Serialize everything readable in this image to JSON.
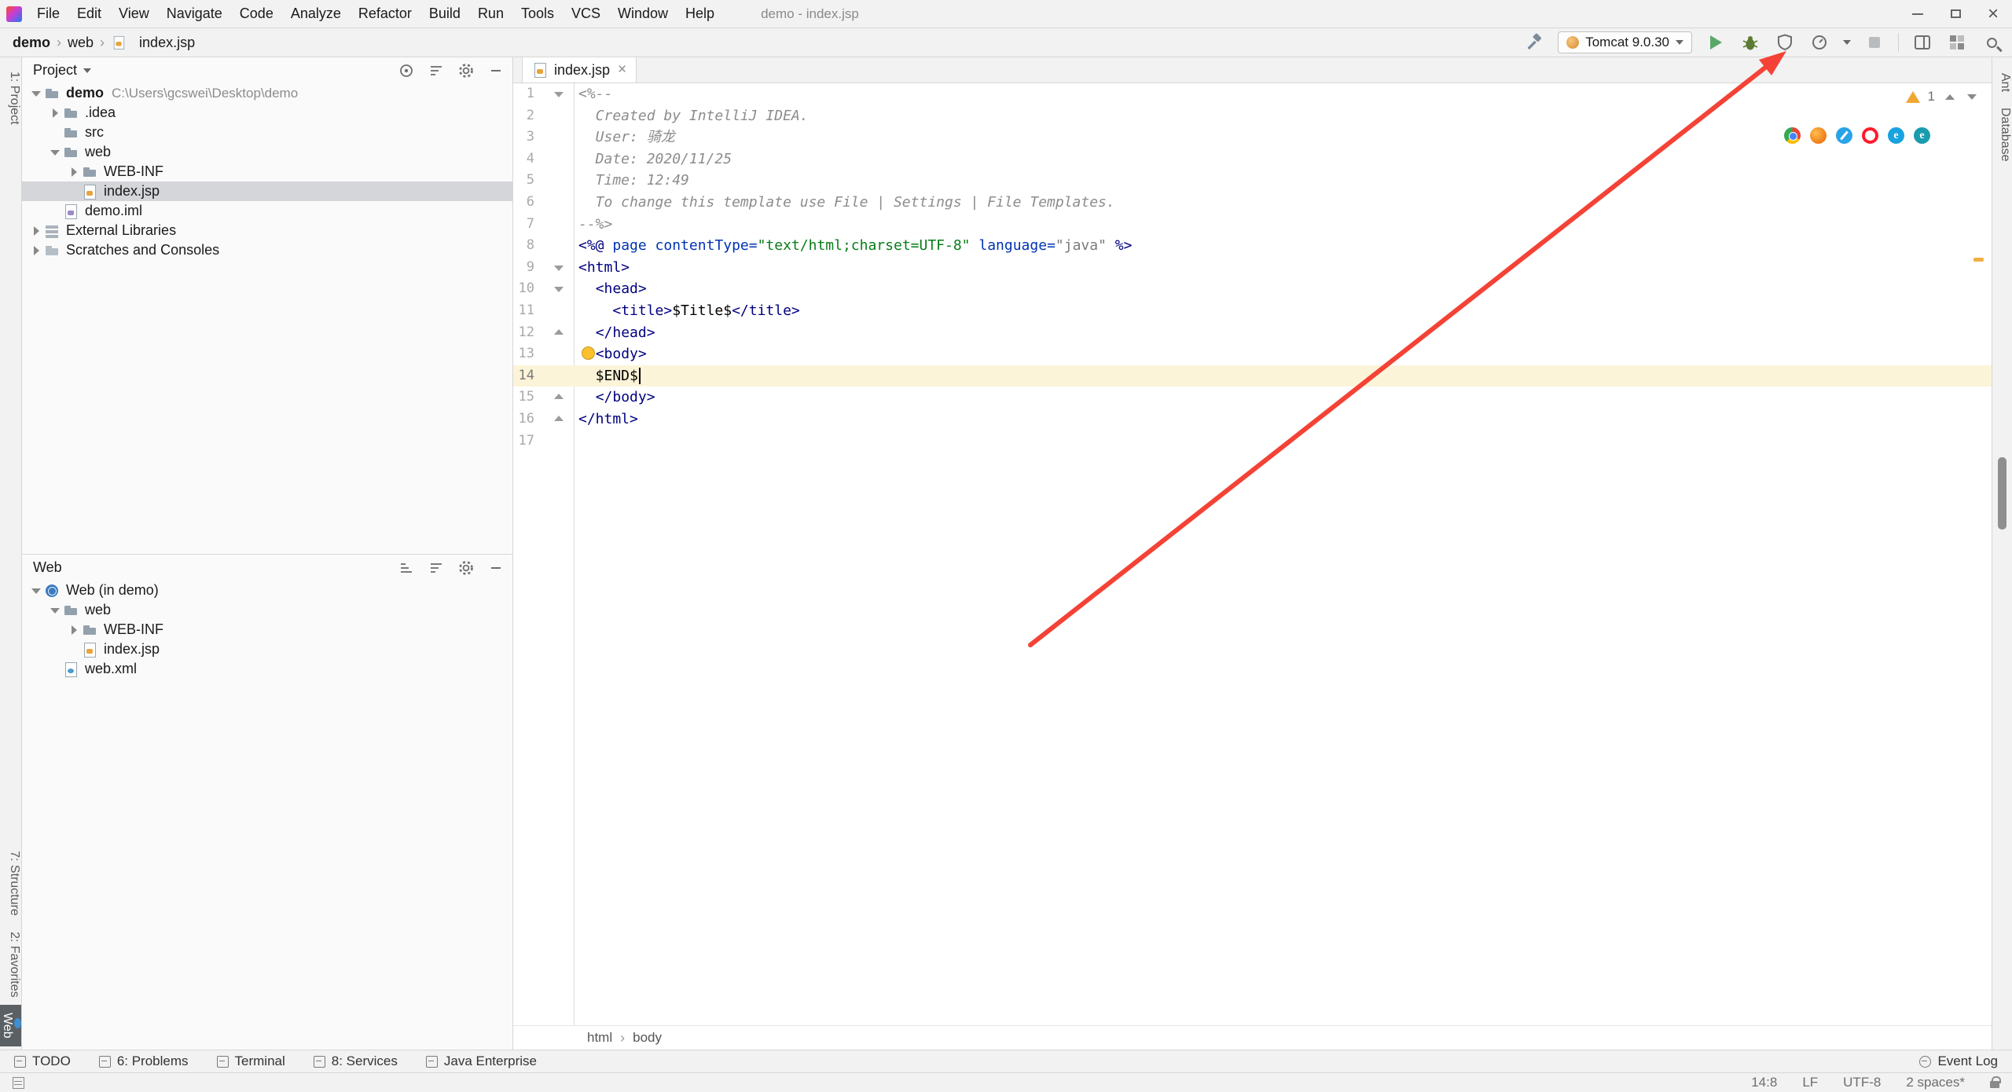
{
  "colors": {
    "annotation_arrow": "#f44336",
    "selection": "#d4d6d9",
    "current_line": "#fcf4d8",
    "run_green": "#59a869",
    "warning_yellow": "#f0a732"
  },
  "titlebar": {
    "title": "demo - index.jsp",
    "menus": [
      "File",
      "Edit",
      "View",
      "Navigate",
      "Code",
      "Analyze",
      "Refactor",
      "Build",
      "Run",
      "Tools",
      "VCS",
      "Window",
      "Help"
    ]
  },
  "toolbar": {
    "separator": "›",
    "breadcrumbs": [
      {
        "label": "demo",
        "bold": true
      },
      {
        "label": "web"
      },
      {
        "label": "index.jsp",
        "icon": "jsp"
      }
    ],
    "run_config": "Tomcat 9.0.30"
  },
  "left_strip": {
    "top": [
      {
        "label": "1: Project",
        "active": false
      }
    ],
    "bottom": [
      {
        "label": "7: Structure",
        "active": false
      },
      {
        "label": "2: Favorites",
        "active": false
      },
      {
        "label": "Web",
        "active": true
      }
    ]
  },
  "right_strip": [
    "Ant",
    "Database"
  ],
  "project_panel": {
    "title": "Project",
    "tree": [
      {
        "depth": 0,
        "chevron": "down",
        "icon": "folder",
        "label": "demo",
        "bold": true,
        "suffix": "C:\\Users\\gcswei\\Desktop\\demo"
      },
      {
        "depth": 1,
        "chevron": "right",
        "icon": "folder",
        "label": ".idea"
      },
      {
        "depth": 1,
        "chevron": "none",
        "icon": "folder",
        "label": "src"
      },
      {
        "depth": 1,
        "chevron": "down",
        "icon": "folder",
        "label": "web"
      },
      {
        "depth": 2,
        "chevron": "right",
        "icon": "folder",
        "label": "WEB-INF"
      },
      {
        "depth": 2,
        "chevron": "none",
        "icon": "jsp",
        "label": "index.jsp",
        "selected": true
      },
      {
        "depth": 1,
        "chevron": "none",
        "icon": "iml",
        "label": "demo.iml"
      },
      {
        "depth": 0,
        "chevron": "right",
        "icon": "lib",
        "label": "External Libraries"
      },
      {
        "depth": 0,
        "chevron": "right",
        "icon": "scratch",
        "label": "Scratches and Consoles"
      }
    ]
  },
  "web_panel": {
    "title": "Web",
    "tree": [
      {
        "depth": 0,
        "chevron": "down",
        "icon": "webmodule",
        "label": "Web (in demo)"
      },
      {
        "depth": 1,
        "chevron": "down",
        "icon": "folder",
        "label": "web"
      },
      {
        "depth": 2,
        "chevron": "right",
        "icon": "folder",
        "label": "WEB-INF"
      },
      {
        "depth": 2,
        "chevron": "none",
        "icon": "jsp",
        "label": "index.jsp"
      },
      {
        "depth": 1,
        "chevron": "none",
        "icon": "webxml",
        "label": "web.xml"
      }
    ]
  },
  "editor": {
    "tab": {
      "label": "index.jsp",
      "close": "×"
    },
    "warning_badge": "1",
    "breadcrumb_separator": "›",
    "breadcrumbs": [
      "html",
      "body"
    ],
    "current_line": 14,
    "lines": [
      {
        "n": 1,
        "fold": "down",
        "seg": [
          {
            "t": "<%--",
            "c": "comment"
          }
        ]
      },
      {
        "n": 2,
        "seg": [
          {
            "t": "  Created by IntelliJ IDEA.",
            "c": "comment"
          }
        ]
      },
      {
        "n": 3,
        "seg": [
          {
            "t": "  User: 骑龙",
            "c": "comment"
          }
        ]
      },
      {
        "n": 4,
        "seg": [
          {
            "t": "  Date: 2020/11/25",
            "c": "comment"
          }
        ]
      },
      {
        "n": 5,
        "seg": [
          {
            "t": "  Time: 12:49",
            "c": "comment"
          }
        ]
      },
      {
        "n": 6,
        "seg": [
          {
            "t": "  To change this template use File | Settings | File Templates.",
            "c": "comment"
          }
        ]
      },
      {
        "n": 7,
        "seg": [
          {
            "t": "--%>",
            "c": "comment"
          }
        ]
      },
      {
        "n": 8,
        "seg": [
          {
            "t": "<%@ ",
            "c": "tag"
          },
          {
            "t": "page ",
            "c": "keyword"
          },
          {
            "t": "contentType=",
            "c": "keyword"
          },
          {
            "t": "\"text/html;charset=UTF-8\"",
            "c": "string"
          },
          {
            "t": " ",
            "c": "plain"
          },
          {
            "t": "language=",
            "c": "keyword"
          },
          {
            "t": "\"java\"",
            "c": "stringlight"
          },
          {
            "t": " %>",
            "c": "tag"
          }
        ]
      },
      {
        "n": 9,
        "fold": "down",
        "seg": [
          {
            "t": "<html>",
            "c": "tag"
          }
        ]
      },
      {
        "n": 10,
        "fold": "down",
        "seg": [
          {
            "t": "  ",
            "c": "plain"
          },
          {
            "t": "<head>",
            "c": "tag"
          }
        ]
      },
      {
        "n": 11,
        "seg": [
          {
            "t": "    ",
            "c": "plain"
          },
          {
            "t": "<title>",
            "c": "tag"
          },
          {
            "t": "$Title$",
            "c": "plain"
          },
          {
            "t": "</title>",
            "c": "tag"
          }
        ]
      },
      {
        "n": 12,
        "fold": "up",
        "seg": [
          {
            "t": "  ",
            "c": "plain"
          },
          {
            "t": "</head>",
            "c": "tag"
          }
        ]
      },
      {
        "n": 13,
        "bulb": true,
        "seg": [
          {
            "t": "  ",
            "c": "plain"
          },
          {
            "t": "<body>",
            "c": "tag"
          }
        ]
      },
      {
        "n": 14,
        "seg": [
          {
            "t": "  $END$",
            "c": "plain"
          }
        ]
      },
      {
        "n": 15,
        "fold": "up",
        "seg": [
          {
            "t": "  ",
            "c": "plain"
          },
          {
            "t": "</body>",
            "c": "tag"
          }
        ]
      },
      {
        "n": 16,
        "fold": "up",
        "seg": [
          {
            "t": "</html>",
            "c": "tag"
          }
        ]
      },
      {
        "n": 17,
        "seg": []
      }
    ]
  },
  "browsers": [
    "chrome",
    "firefox",
    "safari",
    "opera",
    "ie",
    "edge"
  ],
  "bottom_tools": {
    "left": [
      {
        "label": "TODO"
      },
      {
        "label": "6: Problems"
      },
      {
        "label": "Terminal"
      },
      {
        "label": "8: Services"
      },
      {
        "label": "Java Enterprise"
      }
    ],
    "event_log": "Event Log"
  },
  "status_bar": {
    "items": [
      "14:8",
      "LF",
      "UTF-8",
      "2 spaces*"
    ]
  }
}
